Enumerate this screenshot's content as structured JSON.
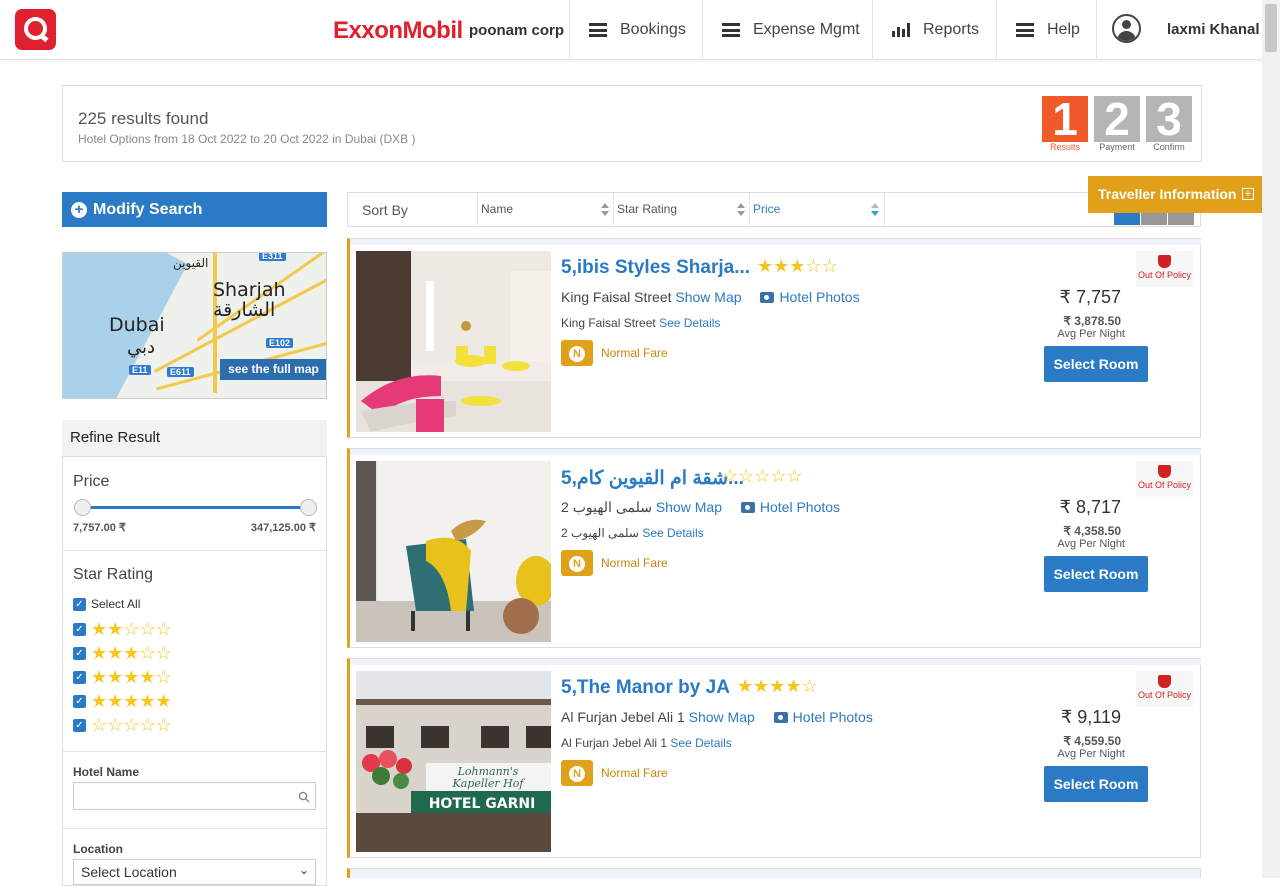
{
  "header": {
    "brand": "ExxonMobil",
    "corp": "poonam corp",
    "nav": [
      {
        "label": "Bookings",
        "icon": "menu-icon"
      },
      {
        "label": "Expense Mgmt",
        "icon": "menu-icon"
      },
      {
        "label": "Reports",
        "icon": "bar-chart-icon"
      },
      {
        "label": "Help",
        "icon": "menu-icon"
      }
    ],
    "user": "laxmi Khanal"
  },
  "summary": {
    "count": "225 results found",
    "options": "Hotel Options from  18 Oct 2022 to 20 Oct 2022 in Dubai (DXB )",
    "steps": [
      {
        "num": "1",
        "label": "Results",
        "color": "#f05a28"
      },
      {
        "num": "2",
        "label": "Payment",
        "color": "#b5b5b5"
      },
      {
        "num": "3",
        "label": "Confirm",
        "color": "#b5b5b5"
      }
    ]
  },
  "sidebar": {
    "modify": "Modify Search",
    "map": {
      "labels": [
        "Sharjah",
        "الشارقة",
        "Dubai",
        "دبي",
        "القيوين"
      ],
      "roads": [
        "E311",
        "E102",
        "E11",
        "E611"
      ],
      "full_map": "see the full map"
    },
    "refine": "Refine Result",
    "price": {
      "title": "Price",
      "min": "7,757.00 ₹",
      "max": "347,125.00 ₹"
    },
    "star_rating": {
      "title": "Star Rating",
      "select_all": "Select All",
      "options": [
        2,
        3,
        4,
        5,
        0
      ]
    },
    "hotel_name": {
      "label": "Hotel Name",
      "placeholder": ""
    },
    "location": {
      "label": "Location",
      "selected": "Select Location"
    }
  },
  "sort": {
    "label": "Sort By",
    "columns": [
      "Name",
      "Star Rating",
      "Price"
    ]
  },
  "traveller": "Traveller Information",
  "hotels": [
    {
      "name": "5,ibis Styles Sharja...",
      "stars": 3,
      "street": "King Faisal Street",
      "show_map": "Show Map",
      "photos": "Hotel Photos",
      "street2": "King Faisal Street",
      "details": "See Details",
      "fare": "Normal Fare",
      "policy": "Out Of Policy",
      "price": "₹ 7,757",
      "per_night": "₹ 3,878.50",
      "avg": "Avg Per Night",
      "select": "Select Room"
    },
    {
      "name": "5,شقة ام القيوين كام...",
      "stars": 0,
      "street": "2 سلمى الهيوب",
      "show_map": "Show Map",
      "photos": "Hotel Photos",
      "street2": "2 سلمى الهيوب",
      "details": "See Details",
      "fare": "Normal Fare",
      "policy": "Out Of Policy",
      "price": "₹ 8,717",
      "per_night": "₹ 4,358.50",
      "avg": "Avg Per Night",
      "select": "Select Room"
    },
    {
      "name": "5,The Manor by JA",
      "stars": 4,
      "street": "Al Furjan Jebel Ali 1",
      "show_map": "Show Map",
      "photos": "Hotel Photos",
      "street2": "Al Furjan Jebel Ali 1",
      "details": "See Details",
      "fare": "Normal Fare",
      "policy": "Out Of Policy",
      "price": "₹ 9,119",
      "per_night": "₹ 4,559.50",
      "avg": "Avg Per Night",
      "select": "Select Room",
      "sign_text": [
        "Lohmann's",
        "Kapeller Hof",
        "HOTEL GARNI"
      ]
    }
  ]
}
